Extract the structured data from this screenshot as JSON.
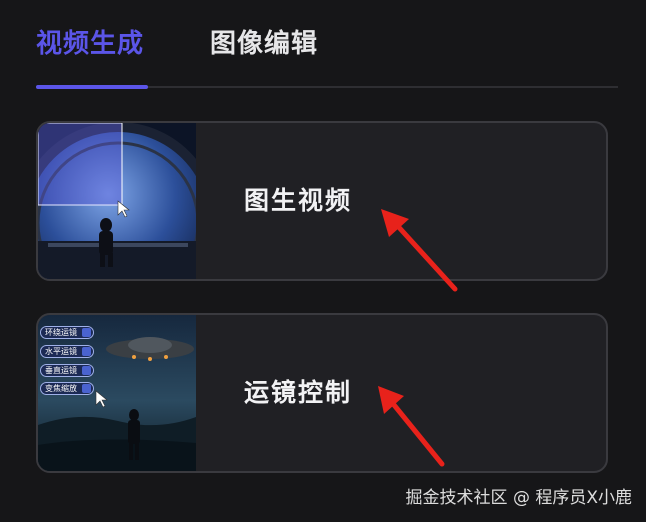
{
  "tabs": [
    {
      "label": "视频生成",
      "active": true
    },
    {
      "label": "图像编辑",
      "active": false
    }
  ],
  "cards": [
    {
      "title": "图生视频"
    },
    {
      "title": "运镜控制",
      "camera_options": [
        "环绕运镜",
        "水平运镜",
        "垂直运镜",
        "变焦缩放"
      ]
    }
  ],
  "watermark": "掘金技术社区 @ 程序员X小鹿",
  "colors": {
    "accent": "#5b55e8",
    "background": "#161618",
    "card": "#202024",
    "arrow": "#e8221b"
  }
}
